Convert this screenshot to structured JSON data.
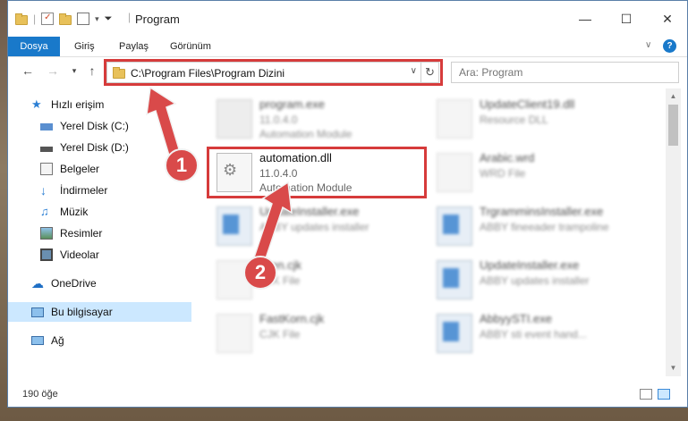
{
  "window": {
    "title": "Program"
  },
  "ribbon": {
    "tabs": [
      "Dosya",
      "Giriş",
      "Paylaş",
      "Görünüm"
    ],
    "help_label": "?"
  },
  "address": {
    "path": "C:\\Program Files\\Program Dizini"
  },
  "search": {
    "placeholder": "Ara: Program"
  },
  "sidebar": {
    "items": [
      {
        "label": "Hızlı erişim",
        "icon": "star-icon"
      },
      {
        "label": "Yerel Disk (C:)",
        "icon": "drive-icon"
      },
      {
        "label": "Yerel Disk (D:)",
        "icon": "drive-icon"
      },
      {
        "label": "Belgeler",
        "icon": "documents-icon"
      },
      {
        "label": "İndirmeler",
        "icon": "download-icon"
      },
      {
        "label": "Müzik",
        "icon": "music-icon"
      },
      {
        "label": "Resimler",
        "icon": "pictures-icon"
      },
      {
        "label": "Videolar",
        "icon": "video-icon"
      },
      {
        "label": "OneDrive",
        "icon": "cloud-icon"
      },
      {
        "label": "Bu bilgisayar",
        "icon": "computer-icon"
      },
      {
        "label": "Ağ",
        "icon": "network-icon"
      }
    ]
  },
  "files": {
    "main": {
      "name": "automation.dll",
      "version": "11.0.4.0",
      "desc": "Automation Module"
    },
    "blurred": [
      {
        "name": "program.exe",
        "line2": "11.0.4.0",
        "line3": "Automation Module"
      },
      {
        "name": "UpdateClient19.dll",
        "line2": "Resource DLL",
        "line3": ""
      },
      {
        "name": "Arabic.wrd",
        "line2": "WRD File",
        "line3": ""
      },
      {
        "name": "UpdateInstaller.exe",
        "line2": "ABBY updates installer",
        "line3": ""
      },
      {
        "name": "TrgramminsInstaller.exe",
        "line2": "ABBY fineeader trampoline",
        "line3": ""
      },
      {
        "name": "ssen.cjk",
        "line2": "CJK File",
        "line3": ""
      },
      {
        "name": "UpdateInstaller.exe",
        "line2": "ABBY updates installer",
        "line3": ""
      },
      {
        "name": "FastKorn.cjk",
        "line2": "CJK File",
        "line3": ""
      },
      {
        "name": "AbbyySTI.exe",
        "line2": "ABBY sti event hand...",
        "line3": ""
      }
    ]
  },
  "status": {
    "count": "190 öğe"
  },
  "annotations": {
    "step1": "1",
    "step2": "2",
    "color": "#d94a4a"
  }
}
